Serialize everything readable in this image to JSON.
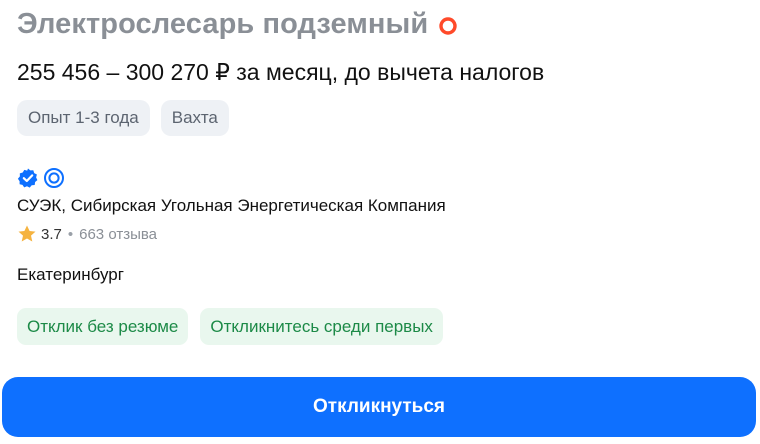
{
  "vacancy": {
    "title": "Электрослесарь подземный",
    "salary": "255 456 – 300 270 ₽ за месяц, до вычета налогов",
    "tags": [
      "Опыт 1-3 года",
      "Вахта"
    ]
  },
  "company": {
    "name": "СУЭК, Сибирская Угольная Энергетическая Компания",
    "rating": "3.7",
    "separator": "•",
    "reviews": "663 отзыва",
    "city": "Екатеринбург"
  },
  "highlights": [
    "Отклик без резюме",
    "Откликнитесь среди первых"
  ],
  "actions": {
    "apply_label": "Откликнуться"
  },
  "icons": {
    "promo": "promo-circle-icon",
    "verified": "verified-check-icon",
    "trusted": "trusted-employer-icon",
    "rating_star": "star-icon"
  },
  "colors": {
    "accent": "#0e70ff",
    "title_gray": "#8a8f96",
    "promo_red": "#ff4a2a",
    "green_text": "#1c8a47",
    "green_bg": "#e9f7ee",
    "star": "#f5b340"
  }
}
